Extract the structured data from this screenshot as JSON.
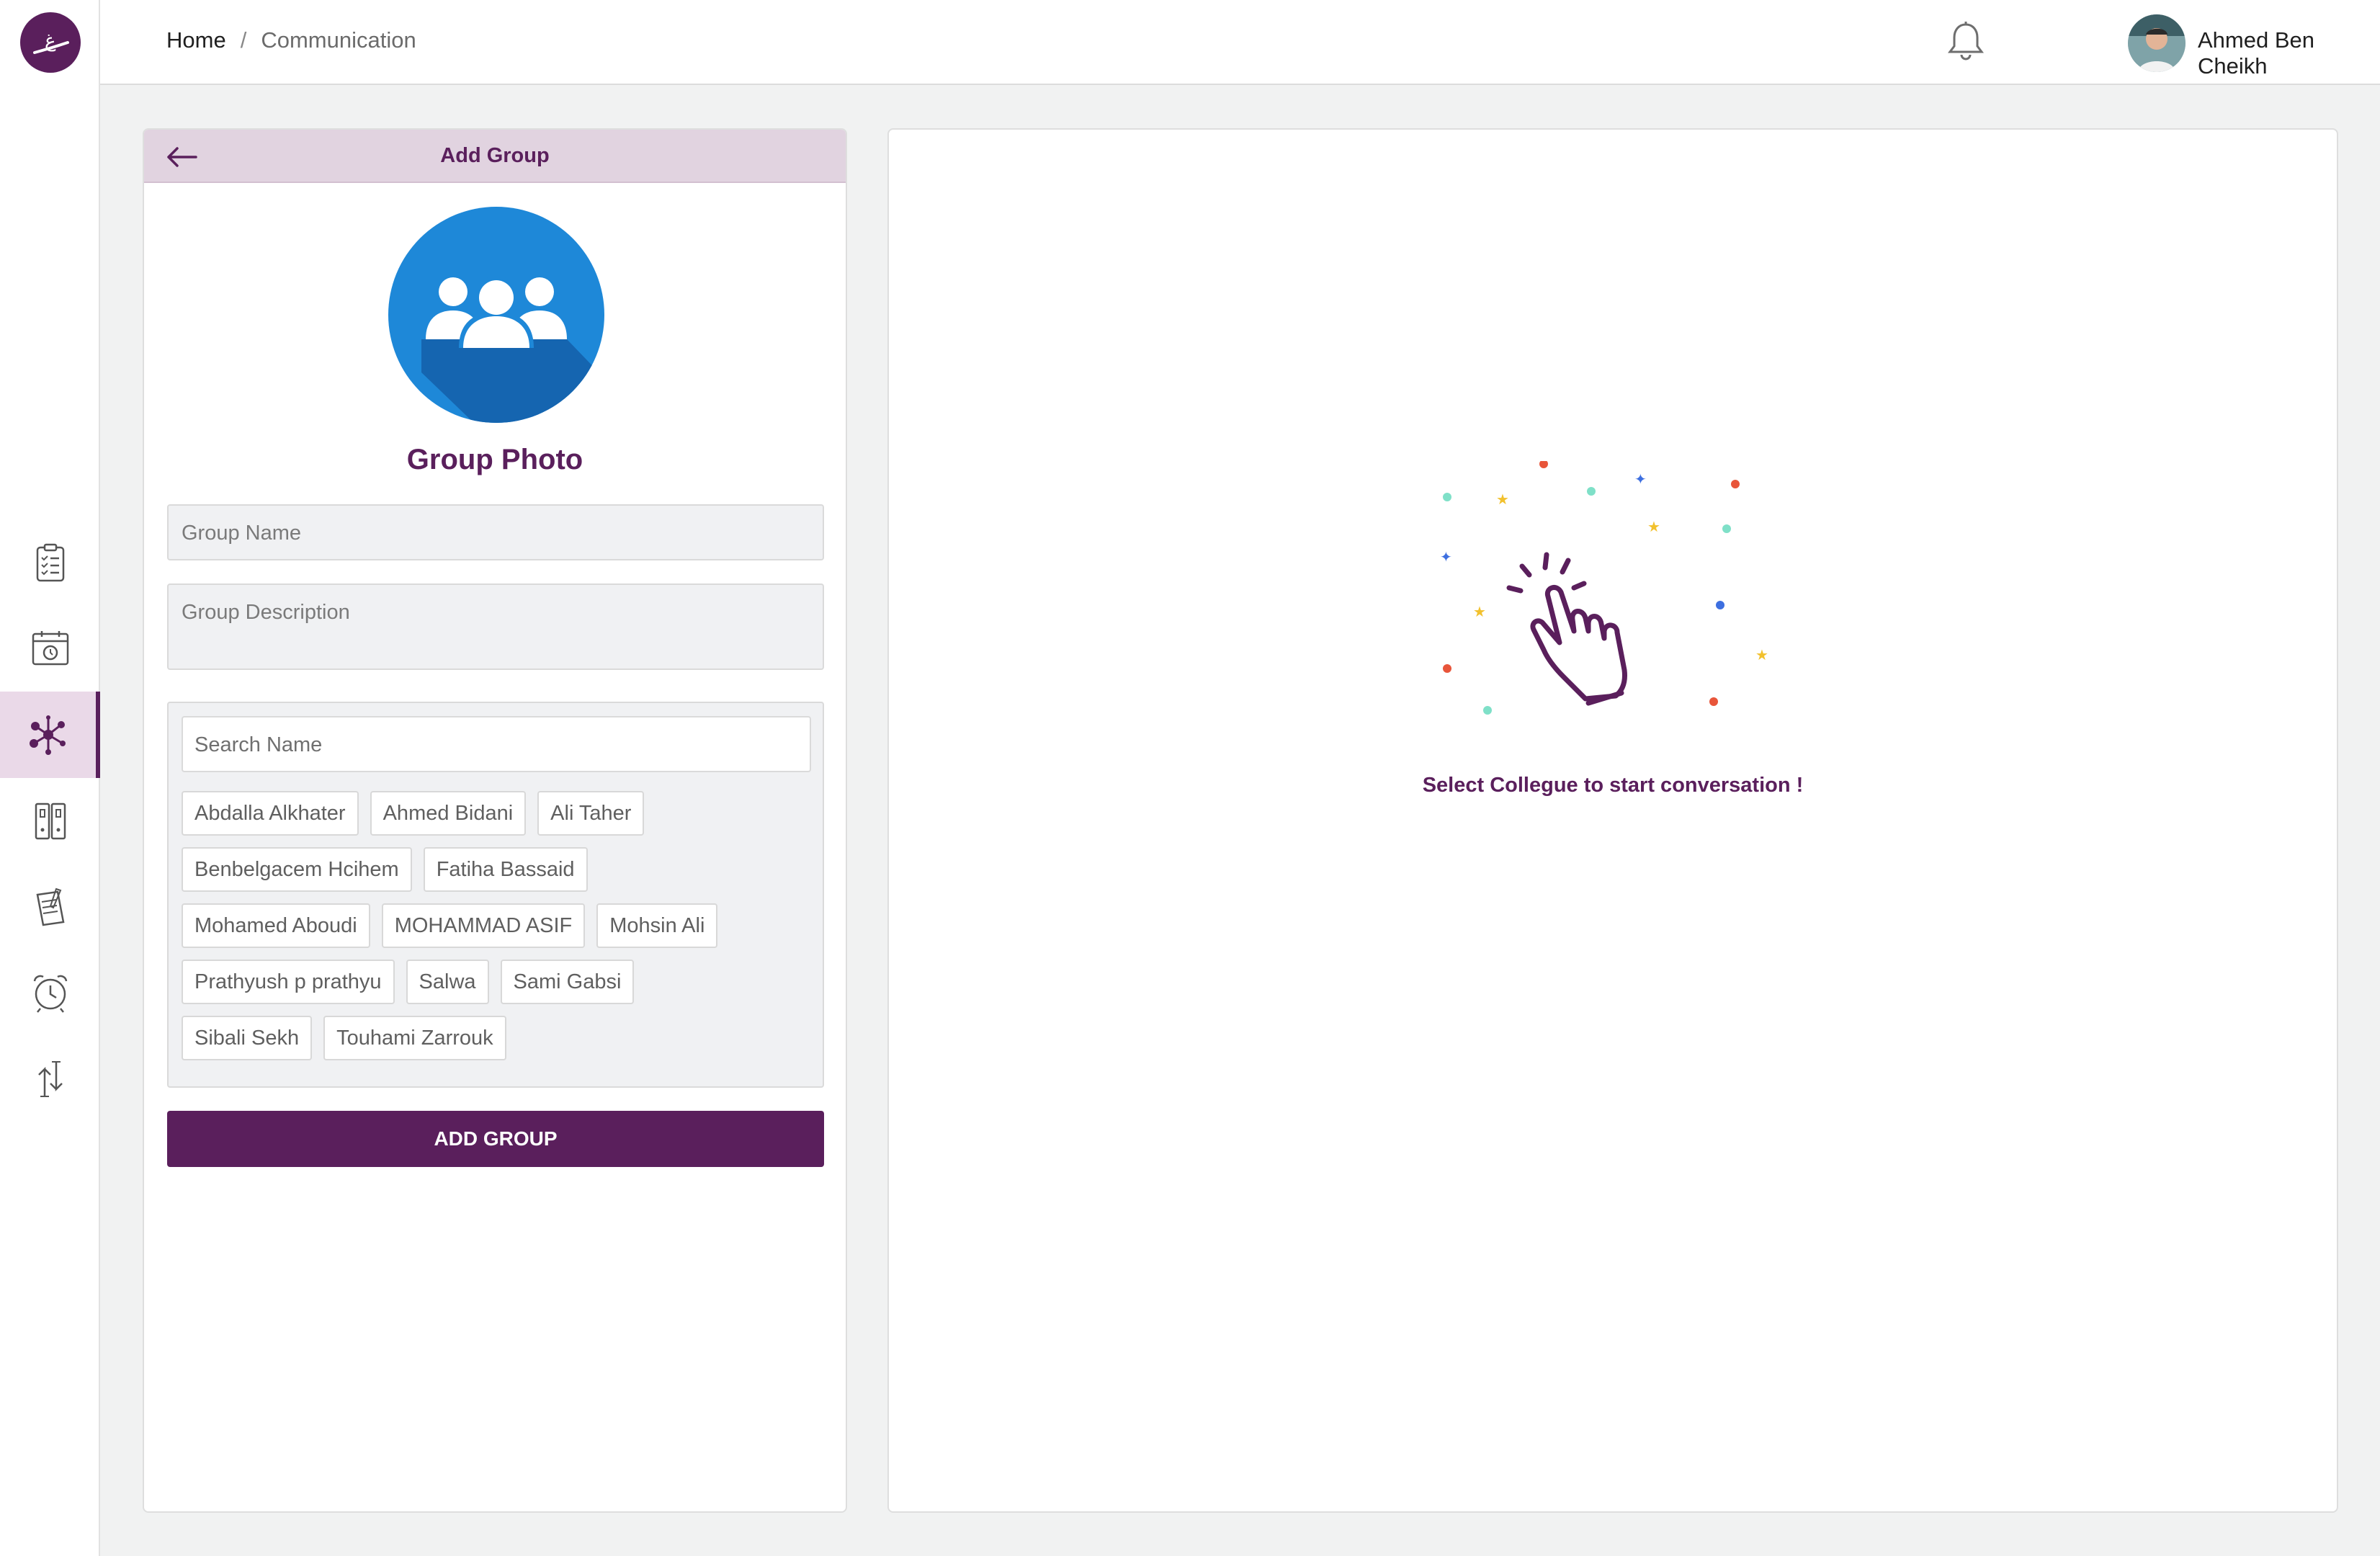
{
  "colors": {
    "brand": "#5a1f5c",
    "header_tint": "#e1d3e0",
    "photo_blue": "#1e88d8"
  },
  "sidebar": {
    "logo_text": "غ",
    "items": [
      {
        "name": "checklist-icon",
        "active": false
      },
      {
        "name": "calendar-icon",
        "active": false
      },
      {
        "name": "network-icon",
        "active": true
      },
      {
        "name": "binders-icon",
        "active": false
      },
      {
        "name": "notepad-icon",
        "active": false
      },
      {
        "name": "alarm-clock-icon",
        "active": false
      },
      {
        "name": "swap-arrows-icon",
        "active": false
      }
    ]
  },
  "header": {
    "breadcrumb": {
      "home": "Home",
      "separator": "/",
      "current": "Communication"
    },
    "user": {
      "name": "Ahmed Ben Cheikh"
    }
  },
  "add_group": {
    "title": "Add Group",
    "photo_label": "Group Photo",
    "group_name_placeholder": "Group Name",
    "group_description_placeholder": "Group Description",
    "search_placeholder": "Search Name",
    "members": [
      [
        "Abdalla Alkhater",
        "Ahmed Bidani",
        "Ali Taher"
      ],
      [
        "Benbelgacem Hcihem",
        "Fatiha Bassaid"
      ],
      [
        "Mohamed Aboudi",
        "MOHAMMAD ASIF",
        "Mohsin Ali"
      ],
      [
        "Prathyush p prathyu",
        "Salwa",
        "Sami Gabsi"
      ],
      [
        "Sibali Sekh",
        "Touhami Zarrouk"
      ]
    ],
    "submit_label": "ADD GROUP"
  },
  "chat": {
    "empty_message": "Select Collegue to start conversation !"
  }
}
